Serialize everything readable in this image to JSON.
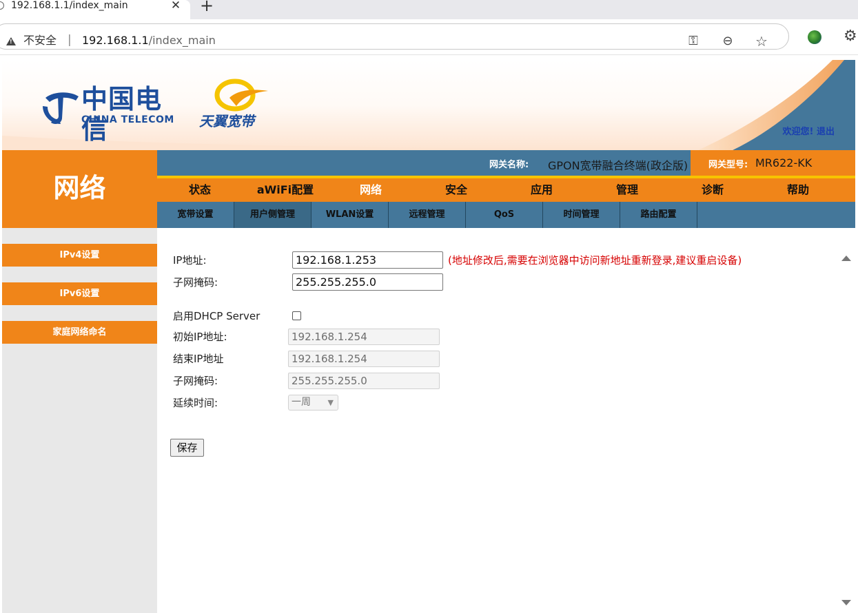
{
  "browser": {
    "tab_title": "192.168.1.1/index_main",
    "tab_close": "✕",
    "new_tab": "+",
    "security_label": "不安全",
    "url_host": "192.168.1.1",
    "url_path": "/index_main"
  },
  "header": {
    "logo_cn": "中国电信",
    "logo_en": "CHINA TELECOM",
    "brand_sub": "天翼宽带",
    "welcome": "欢迎您!",
    "logout": "退出",
    "section_title": "网络",
    "gateway_name_label": "网关名称:",
    "gateway_name_value": "GPON宽带融合终端(政企版)",
    "gateway_model_label": "网关型号:",
    "gateway_model_value": "MR622-KK"
  },
  "main_nav": [
    {
      "label": "状态",
      "active": false
    },
    {
      "label": "aWiFi配置",
      "active": false
    },
    {
      "label": "网络",
      "active": true
    },
    {
      "label": "安全",
      "active": false
    },
    {
      "label": "应用",
      "active": false
    },
    {
      "label": "管理",
      "active": false
    },
    {
      "label": "诊断",
      "active": false
    },
    {
      "label": "帮助",
      "active": false
    }
  ],
  "sub_nav": [
    {
      "label": "宽带设置",
      "active": false
    },
    {
      "label": "用户侧管理",
      "active": true
    },
    {
      "label": "WLAN设置",
      "active": false
    },
    {
      "label": "远程管理",
      "active": false
    },
    {
      "label": "QoS",
      "active": false
    },
    {
      "label": "时间管理",
      "active": false
    },
    {
      "label": "路由配置",
      "active": false
    }
  ],
  "sidebar": {
    "items": [
      {
        "label": "IPv4设置"
      },
      {
        "label": "IPv6设置"
      },
      {
        "label": "家庭网络命名"
      }
    ]
  },
  "form": {
    "ip_label": "IP地址:",
    "ip_value": "192.168.1.253",
    "ip_hint": "(地址修改后,需要在浏览器中访问新地址重新登录,建议重启设备)",
    "mask_label": "子网掩码:",
    "mask_value": "255.255.255.0",
    "dhcp_label": "启用DHCP Server",
    "dhcp_enabled": false,
    "start_ip_label": "初始IP地址:",
    "start_ip_value": "192.168.1.254",
    "end_ip_label": "结束IP地址",
    "end_ip_value": "192.168.1.254",
    "dhcp_mask_label": "子网掩码:",
    "dhcp_mask_value": "255.255.255.0",
    "lease_label": "延续时间:",
    "lease_value": "一周",
    "save_label": "保存"
  },
  "colors": {
    "orange": "#f08519",
    "steel_blue": "#44779a",
    "yellow_divider": "#f7c400",
    "hint_red": "#d60000",
    "link_blue": "#1a3fb0"
  }
}
